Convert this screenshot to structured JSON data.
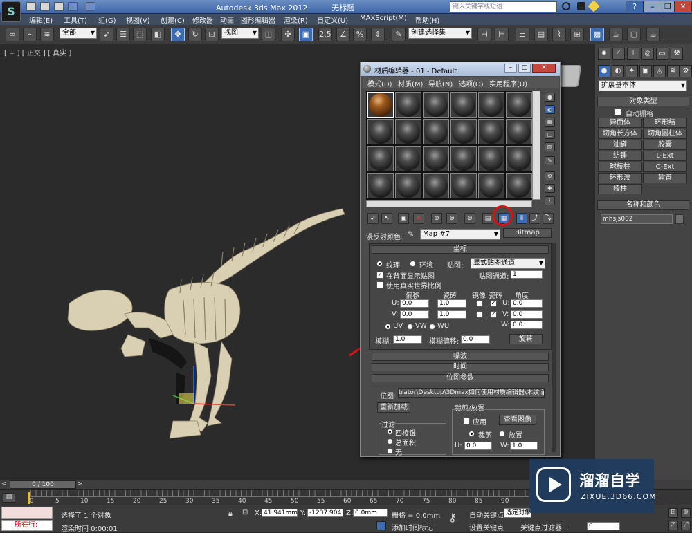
{
  "titlebar": {
    "app": "Autodesk 3ds Max 2012",
    "doc": "无标题",
    "search_placeholder": "键入关键字或短语"
  },
  "menus": [
    "编辑(E)",
    "工具(T)",
    "组(G)",
    "视图(V)",
    "创建(C)",
    "修改器",
    "动画",
    "图形编辑器",
    "渲染(R)",
    "自定义(U)",
    "MAXScript(M)",
    "帮助(H)"
  ],
  "toolbar": {
    "selection_filter": "全部",
    "ref_coord": "视图",
    "snap_angle": "2.5",
    "named_sel": "创建选择集"
  },
  "viewport": {
    "label": "[ + ] [ 正交 ] [ 真实 ]"
  },
  "cmdpanel": {
    "category": "扩展基本体",
    "object_type_header": "对象类型",
    "autogrid": "自动栅格",
    "buttons": [
      "异面体",
      "环形结",
      "切角长方体",
      "切角圆柱体",
      "油罐",
      "胶囊",
      "纺锤",
      "L-Ext",
      "球棱柱",
      "C-Ext",
      "环形波",
      "软管",
      "棱柱"
    ],
    "name_color_header": "名称和颜色",
    "object_name": "mhsjs002"
  },
  "material_editor": {
    "title": "材质编辑器 - 01 - Default",
    "menus": [
      "模式(D)",
      "材质(M)",
      "导航(N)",
      "选项(O)",
      "实用程序(U)"
    ],
    "diffuse_label": "漫反射颜色:",
    "map_name": "Map #7",
    "map_type": "Bitmap",
    "coords": {
      "header": "坐标",
      "texture": "纹理",
      "environ": "环境",
      "mapping_label": "贴图:",
      "mapping": "显式贴图通道",
      "show_back": "在背面显示贴图",
      "map_channel_label": "贴图通道:",
      "map_channel": "1",
      "real_world": "使用真实世界比例",
      "offset": "偏移",
      "tiling": "瓷砖",
      "mirror": "镜像",
      "tile": "瓷砖",
      "angle": "角度",
      "u_label": "U:",
      "v_label": "V:",
      "w_label": "W:",
      "u_offset": "0.0",
      "u_tiling": "1.0",
      "u_angle": "0.0",
      "v_offset": "0.0",
      "v_tiling": "1.0",
      "v_angle": "0.0",
      "w_angle": "0.0",
      "uv": "UV",
      "vw": "VW",
      "wu": "WU",
      "blur_label": "模糊:",
      "blur": "1.0",
      "blur_offset_label": "模糊偏移:",
      "blur_offset": "0.0",
      "rotate": "旋转"
    },
    "noise": "噪波",
    "time": "时间",
    "bitmap_params": {
      "header": "位图参数",
      "bitmap_label": "位图:",
      "path": "trator\\Desktop\\3Dmax如何使用材质编辑器\\木纹.jpg",
      "reload": "重新加载",
      "crop_place": "裁剪/放置",
      "apply": "应用",
      "view_image": "查看图像",
      "crop": "裁剪",
      "place": "放置",
      "u": "U:",
      "u_val": "0.0",
      "w": "W:",
      "w_val": "1.0",
      "filter": "过滤",
      "pyramidal": "四棱锥",
      "summed": "总面积",
      "none": "无"
    }
  },
  "timeline": {
    "frame": "0 / 100",
    "ticks": [
      "0",
      "5",
      "10",
      "15",
      "20",
      "25",
      "30",
      "35",
      "40",
      "45",
      "50",
      "55",
      "60",
      "65",
      "70",
      "75",
      "80",
      "85",
      "90"
    ]
  },
  "status": {
    "running": "所在行:",
    "selected": "选择了 1 个对象",
    "render_time": "渲染时间  0:00:01",
    "x_label": "X:",
    "x": "41.941mm",
    "y_label": "Y:",
    "y": "-1237.904",
    "z_label": "Z:",
    "z": "0.0mm",
    "grid": "栅格 = 0.0mm",
    "add_time_tag": "添加时间标记",
    "auto_key": "自动关键点",
    "set_key": "设置关键点",
    "selected_obj": "选定对象",
    "key_filters": "关键点过滤器...",
    "frame_val": "0"
  },
  "watermark": {
    "brand": "溜溜自学",
    "url": "ZIXUE.3D66.COM"
  },
  "colors": {
    "accent": "#3d6db0",
    "highlight_circle": "#e01010",
    "arrow": "#d41515"
  }
}
